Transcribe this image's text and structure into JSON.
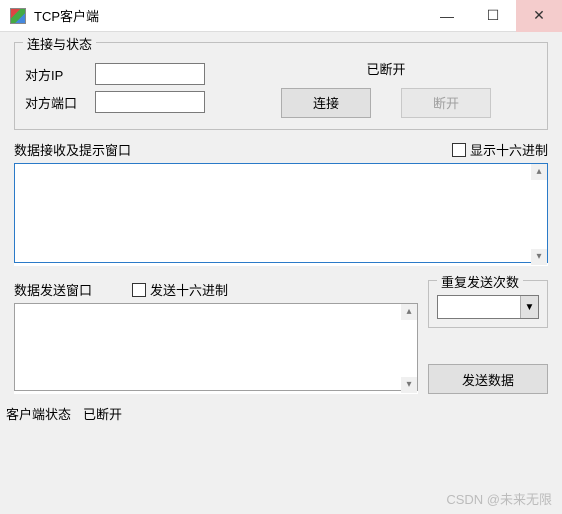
{
  "titlebar": {
    "title": "TCP客户端"
  },
  "connection": {
    "group_label": "连接与状态",
    "ip_label": "对方IP",
    "ip_value": "",
    "port_label": "对方端口",
    "port_value": "",
    "status_text": "已断开",
    "connect_label": "连接",
    "disconnect_label": "断开"
  },
  "recv": {
    "header_label": "数据接收及提示窗口",
    "show_hex_label": "显示十六进制",
    "content": ""
  },
  "send": {
    "header_label": "数据发送窗口",
    "send_hex_label": "发送十六进制",
    "content": "",
    "repeat_group_label": "重复发送次数",
    "repeat_value": "",
    "send_button_label": "发送数据"
  },
  "statusbar": {
    "label": "客户端状态",
    "value": "已断开"
  },
  "watermark": "CSDN @未来无限"
}
